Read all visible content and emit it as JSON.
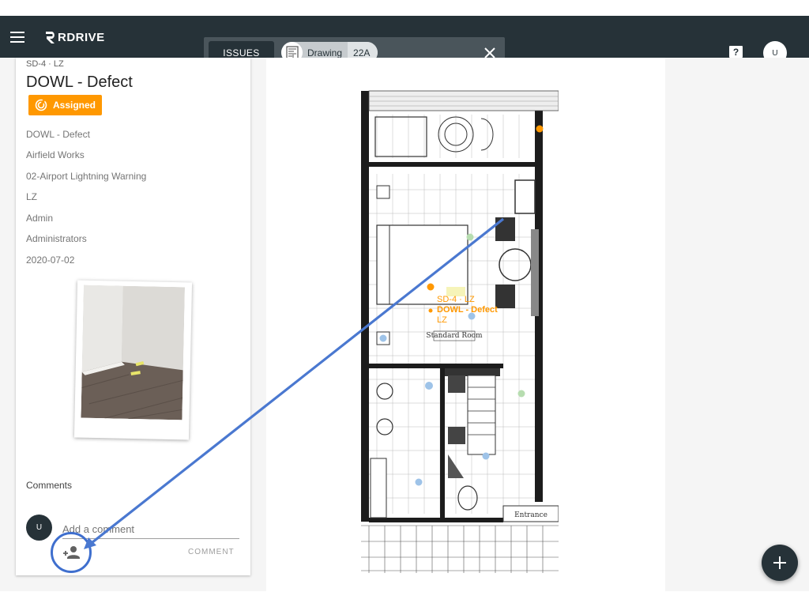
{
  "app": {
    "brand": "RDRIVE"
  },
  "header": {
    "tab_issues": "ISSUES",
    "chip_label": "Drawing",
    "chip_count": "22A",
    "user_initial": "U"
  },
  "issue": {
    "subtitle": "SD-4 · LZ",
    "title": "DOWL - Defect",
    "status": "Assigned",
    "details": [
      "DOWL - Defect",
      "Airfield Works",
      "02-Airport Lightning Warning",
      "LZ",
      "Admin",
      "Administrators",
      "2020-07-02"
    ]
  },
  "comments": {
    "label": "Comments",
    "avatar_initial": "U",
    "placeholder": "Add a comment",
    "submit_label": "COMMENT"
  },
  "drawing_pin": {
    "code": "SD-4 · LZ",
    "title": "DOWL - Defect",
    "zone": "LZ",
    "room_label": "Standard Room",
    "entrance_label": "Entrance"
  },
  "colors": {
    "appbar": "#263238",
    "accent": "#ff9800",
    "annotation": "#3f6fce"
  }
}
